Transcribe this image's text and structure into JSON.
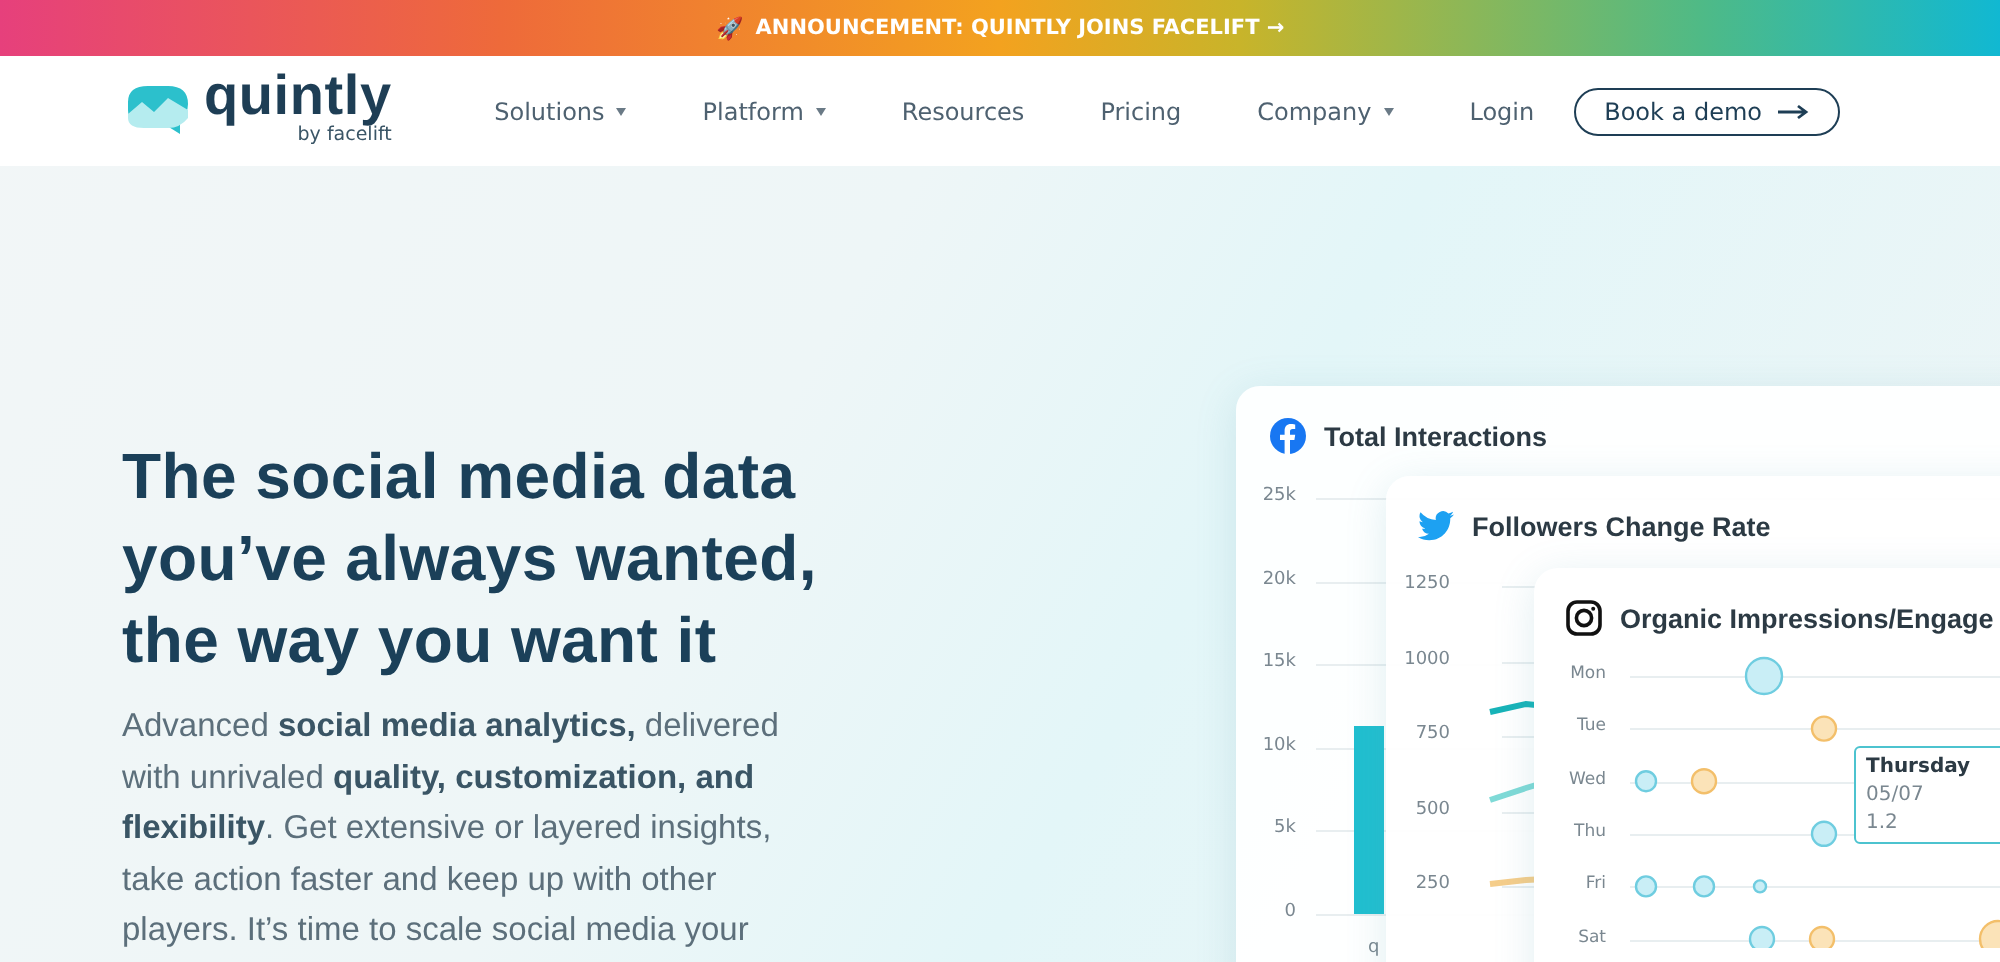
{
  "announcement": {
    "icon": "🚀",
    "text": "ANNOUNCEMENT: QUINTLY JOINS FACELIFT →"
  },
  "logo": {
    "name": "quintly",
    "tagline": "by facelift"
  },
  "nav": [
    {
      "label": "Solutions",
      "dropdown": true
    },
    {
      "label": "Platform",
      "dropdown": true
    },
    {
      "label": "Resources",
      "dropdown": false
    },
    {
      "label": "Pricing",
      "dropdown": false
    },
    {
      "label": "Company",
      "dropdown": true
    },
    {
      "label": "Login",
      "dropdown": false
    }
  ],
  "cta": {
    "label": "Book a demo"
  },
  "hero": {
    "title": "The social media data you’ve always wanted, the way you want it",
    "text": "Advanced **social media analytics,** delivered with unrivaled **quality, customization, and flexibility**. Get extensive or layered insights, take action faster and keep up with other players. It’s time to scale social media your"
  },
  "cards": [
    {
      "kind": "facebook",
      "title": "Total Interactions",
      "axis": [
        "25k",
        "20k",
        "15k",
        "10k",
        "5k",
        "0"
      ],
      "category": "q"
    },
    {
      "kind": "twitter",
      "title": "Followers Change Rate",
      "axis": [
        "1250",
        "1000",
        "750",
        "500",
        "250"
      ]
    },
    {
      "kind": "instagram",
      "title": "Organic Impressions/Engage",
      "rows": [
        "Mon",
        "Tue",
        "Wed",
        "Thu",
        "Fri",
        "Sat"
      ],
      "tooltip": {
        "title": "Thursday",
        "date": "05/07",
        "value": "1.2"
      }
    }
  ]
}
